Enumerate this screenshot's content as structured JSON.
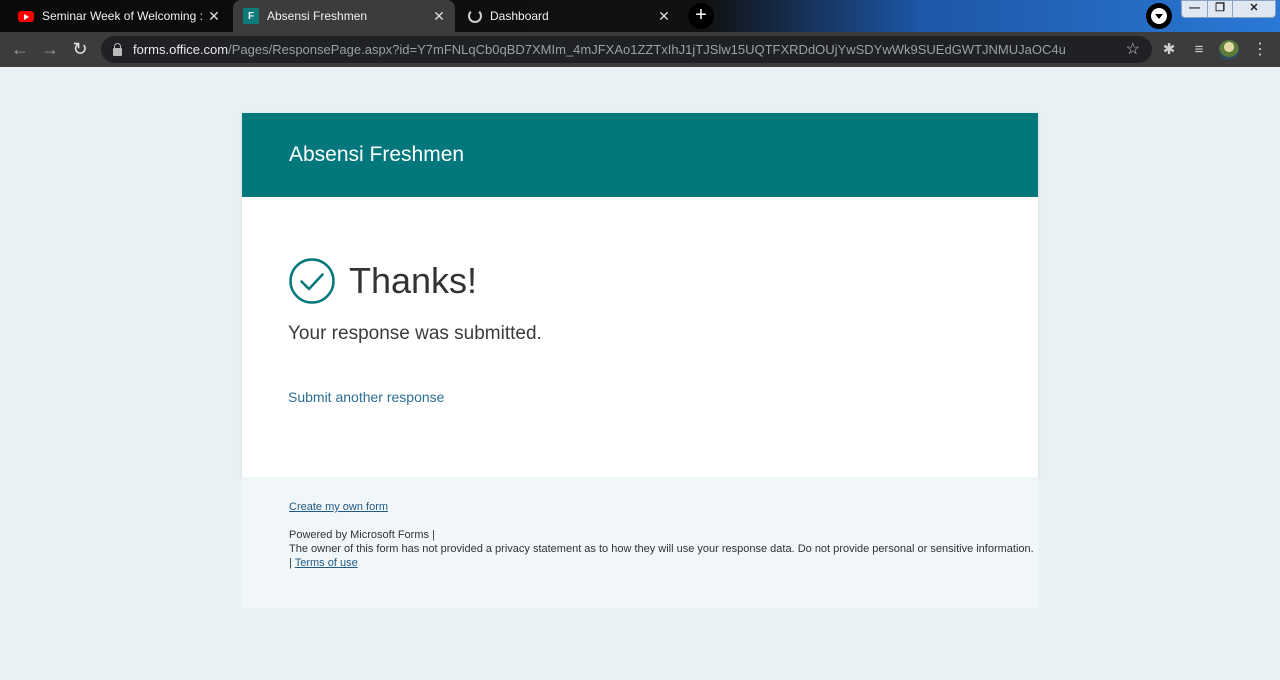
{
  "browser": {
    "tabs": [
      {
        "title": "Seminar Week of Welcoming : \"U",
        "icon": "youtube-icon"
      },
      {
        "title": "Absensi Freshmen",
        "icon": "microsoft-forms-icon"
      },
      {
        "title": "Dashboard",
        "icon": "loading-spinner-icon"
      }
    ],
    "close_glyph": "✕",
    "new_tab_glyph": "+",
    "window_controls": {
      "minimize": "—",
      "maximize": "❐",
      "close": "✕"
    },
    "url_host": "forms.office.com",
    "url_path": "/Pages/ResponsePage.aspx?id=Y7mFNLqCb0qBD7XMIm_4mJFXAo1ZZTxIhJ1jTJSlw15UQTFXRDdOUjYwSDYwWk9SUEdGWTJNMUJaOC4u"
  },
  "form": {
    "title": "Absensi Freshmen",
    "thanks": "Thanks!",
    "submitted": "Your response was submitted.",
    "submit_another": "Submit another response",
    "accent_color": "#03787c"
  },
  "footer": {
    "create_form": "Create my own form",
    "powered_by": "Powered by Microsoft Forms |",
    "privacy_notice": "The owner of this form has not provided a privacy statement as to how they will use your response data. Do not provide personal or sensitive information.",
    "pipe": "|",
    "terms": "Terms of use"
  }
}
